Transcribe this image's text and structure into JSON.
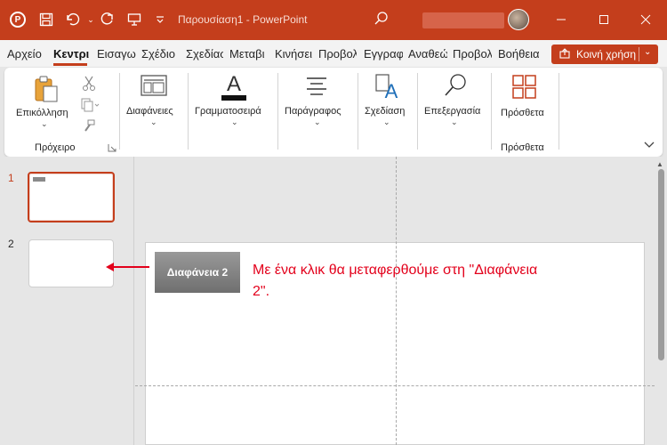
{
  "titlebar": {
    "title": "Παρουσίαση1  -  PowerPoint",
    "app_logo_letter": "P",
    "icons": [
      "powerpoint-logo-icon",
      "save-icon",
      "undo-icon",
      "redo-icon",
      "present-icon",
      "customize-icon",
      "search-icon",
      "minimize-icon",
      "maximize-icon",
      "close-icon"
    ],
    "color": "#c43e1c"
  },
  "tabs": [
    {
      "label": "Αρχείο"
    },
    {
      "label": "Κεντρι"
    },
    {
      "label": "Εισαγω"
    },
    {
      "label": "Σχέδιο"
    },
    {
      "label": "Σχεδίασ"
    },
    {
      "label": "Μεταβι"
    },
    {
      "label": "Κινήσει"
    },
    {
      "label": "Προβολ"
    },
    {
      "label": "Εγγραφ"
    },
    {
      "label": "Αναθεώ"
    },
    {
      "label": "Προβολ"
    },
    {
      "label": "Βοήθεια"
    }
  ],
  "share": {
    "label": "Κοινή χρήση"
  },
  "ribbon": {
    "paste": "Επικόλληση",
    "clipboard": "Πρόχειρο",
    "slides": "Διαφάνειες",
    "font": "Γραμματοσειρά",
    "paragraph": "Παράγραφος",
    "drawing": "Σχεδίαση",
    "editing": "Επεξεργασία",
    "addins": "Πρόσθετα",
    "addins_group": "Πρόσθετα"
  },
  "slides_pane": [
    {
      "number": "1"
    },
    {
      "number": "2"
    }
  ],
  "slide": {
    "button_label": "Διαφάνεια 2",
    "annotation": "Με ένα κλικ θα μεταφερθούμε στη \"Διαφάνεια 2\"."
  },
  "colors": {
    "accent": "#c43e1c",
    "annotation": "#e3001b"
  }
}
